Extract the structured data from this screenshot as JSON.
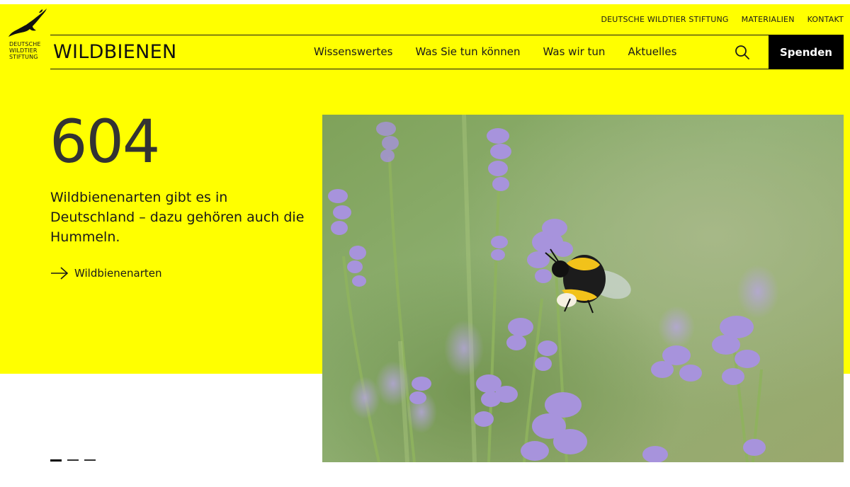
{
  "logo": {
    "lines": [
      "DEUTSCHE",
      "WILDTIER",
      "STIFTUNG"
    ]
  },
  "meta_nav": [
    {
      "label": "DEUTSCHE WILDTIER STIFTUNG"
    },
    {
      "label": "MATERIALIEN"
    },
    {
      "label": "KONTAKT"
    }
  ],
  "header": {
    "title": "WILDBIENEN",
    "nav": [
      {
        "label": "Wissenswertes"
      },
      {
        "label": "Was Sie tun können"
      },
      {
        "label": "Was wir tun"
      },
      {
        "label": "Aktuelles"
      }
    ],
    "search_icon": "search-icon",
    "donate_label": "Spenden"
  },
  "hero": {
    "number": "604",
    "text": "Wildbienenarten gibt es in Deutschland – dazu gehören auch die Hummeln.",
    "link_label": "Wildbienenarten",
    "link_icon": "arrow-right-icon",
    "image": "bumblebee-on-lavender-photo"
  },
  "slider": {
    "count": 3,
    "active_index": 0
  },
  "colors": {
    "brand_yellow": "#ffff00",
    "donate_bg": "#000000",
    "text": "#1a1a1a"
  }
}
